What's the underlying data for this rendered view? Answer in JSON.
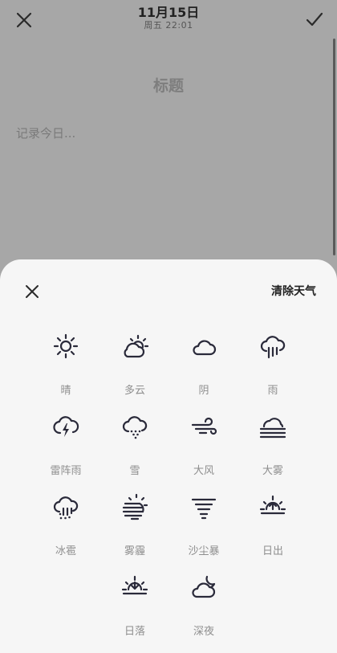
{
  "header": {
    "date": "11月15日",
    "subtitle": "周五 22:01"
  },
  "note": {
    "title": "标题",
    "body_placeholder": "记录今日..."
  },
  "weather_sheet": {
    "clear_label": "清除天气",
    "options": [
      {
        "label": "晴",
        "icon": "sun-icon"
      },
      {
        "label": "多云",
        "icon": "partly-cloudy-icon"
      },
      {
        "label": "阴",
        "icon": "cloud-icon"
      },
      {
        "label": "雨",
        "icon": "rain-icon"
      },
      {
        "label": "雷阵雨",
        "icon": "thunderstorm-icon"
      },
      {
        "label": "雪",
        "icon": "snow-icon"
      },
      {
        "label": "大风",
        "icon": "wind-icon"
      },
      {
        "label": "大雾",
        "icon": "fog-icon"
      },
      {
        "label": "冰雹",
        "icon": "hail-icon"
      },
      {
        "label": "雾霾",
        "icon": "haze-icon"
      },
      {
        "label": "沙尘暴",
        "icon": "sandstorm-icon"
      },
      {
        "label": "日出",
        "icon": "sunrise-icon"
      },
      {
        "label": "日落",
        "icon": "sunset-icon"
      },
      {
        "label": "深夜",
        "icon": "night-icon"
      }
    ]
  }
}
